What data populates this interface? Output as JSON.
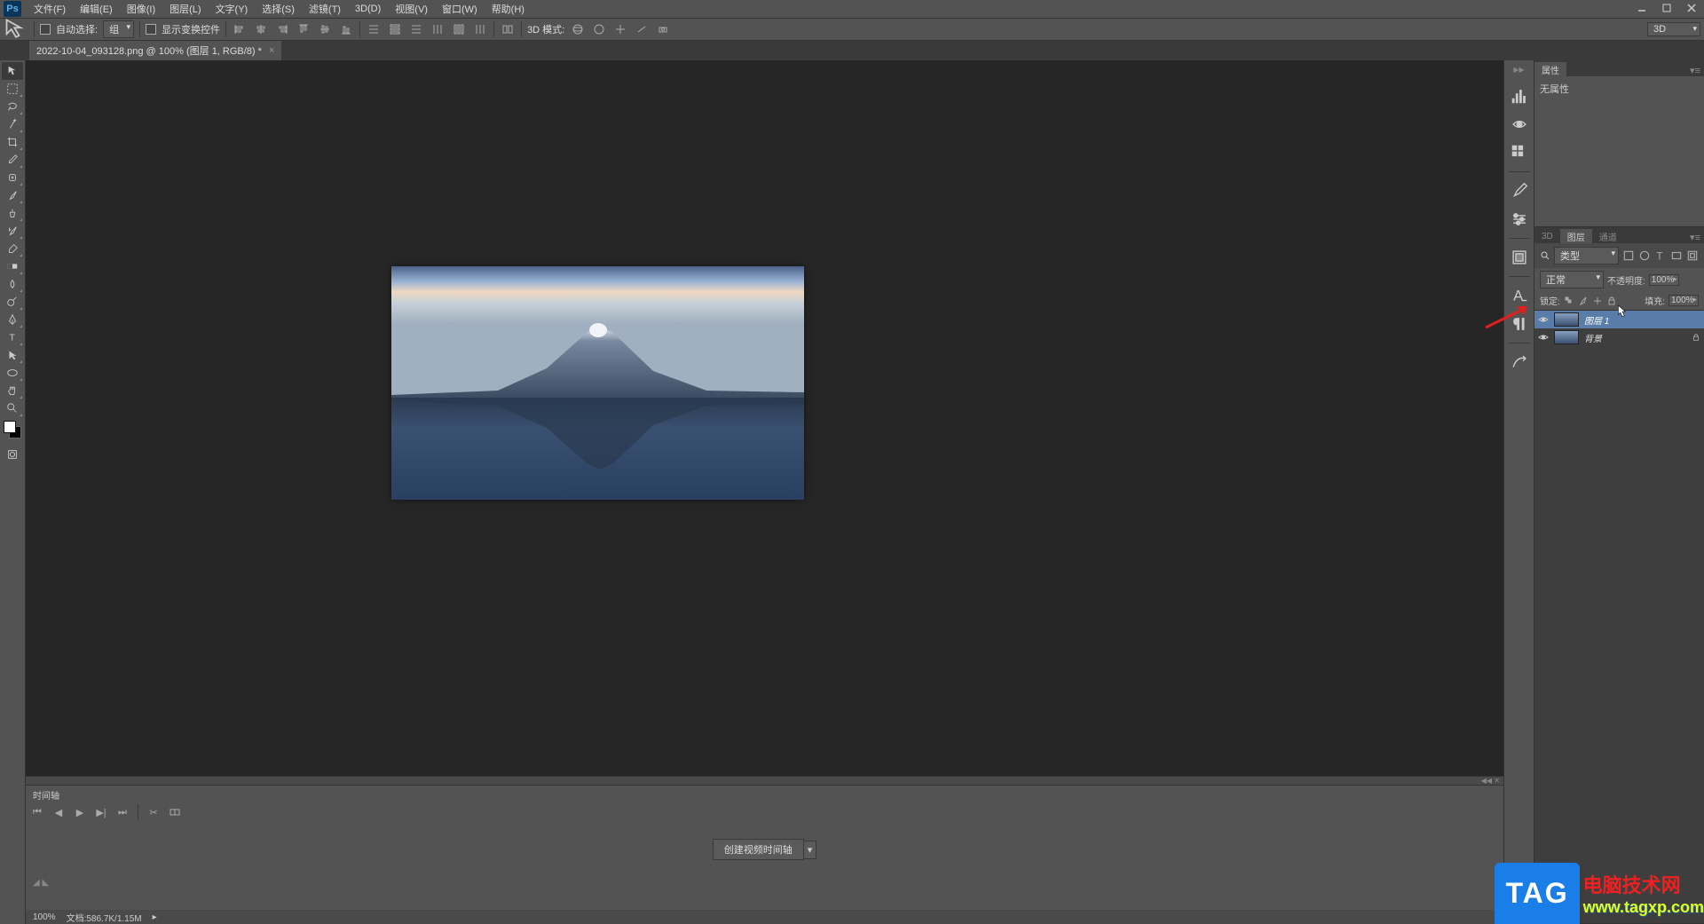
{
  "menubar": {
    "items": [
      "文件(F)",
      "编辑(E)",
      "图像(I)",
      "图层(L)",
      "文字(Y)",
      "选择(S)",
      "滤镜(T)",
      "3D(D)",
      "视图(V)",
      "窗口(W)",
      "帮助(H)"
    ]
  },
  "options_bar": {
    "auto_select": "自动选择:",
    "group_sel": "组",
    "show_transform": "显示变换控件",
    "mode_3d": "3D 模式:",
    "mode_3d_right": "3D"
  },
  "document": {
    "tab_title": "2022-10-04_093128.png @ 100% (图层 1, RGB/8) *"
  },
  "panels": {
    "properties": {
      "tab": "属性",
      "none": "无属性"
    },
    "layers": {
      "tabs": [
        "3D",
        "图层",
        "通道"
      ],
      "filter_label": "类型",
      "blend_mode": "正常",
      "opacity_label": "不透明度:",
      "opacity_value": "100%",
      "lock_label": "锁定:",
      "fill_label": "填充:",
      "fill_value": "100%",
      "layers": [
        {
          "name": "图层 1",
          "selected": true,
          "locked": false
        },
        {
          "name": "背景",
          "selected": false,
          "locked": true
        }
      ]
    }
  },
  "timeline": {
    "tab": "时间轴",
    "create_button": "创建视频时间轴"
  },
  "status": {
    "zoom": "100%",
    "doc_info": "文档:586.7K/1.15M"
  },
  "watermark": {
    "tag": "TAG",
    "line1": "电脑技术网",
    "line2": "www.tagxp.com"
  }
}
